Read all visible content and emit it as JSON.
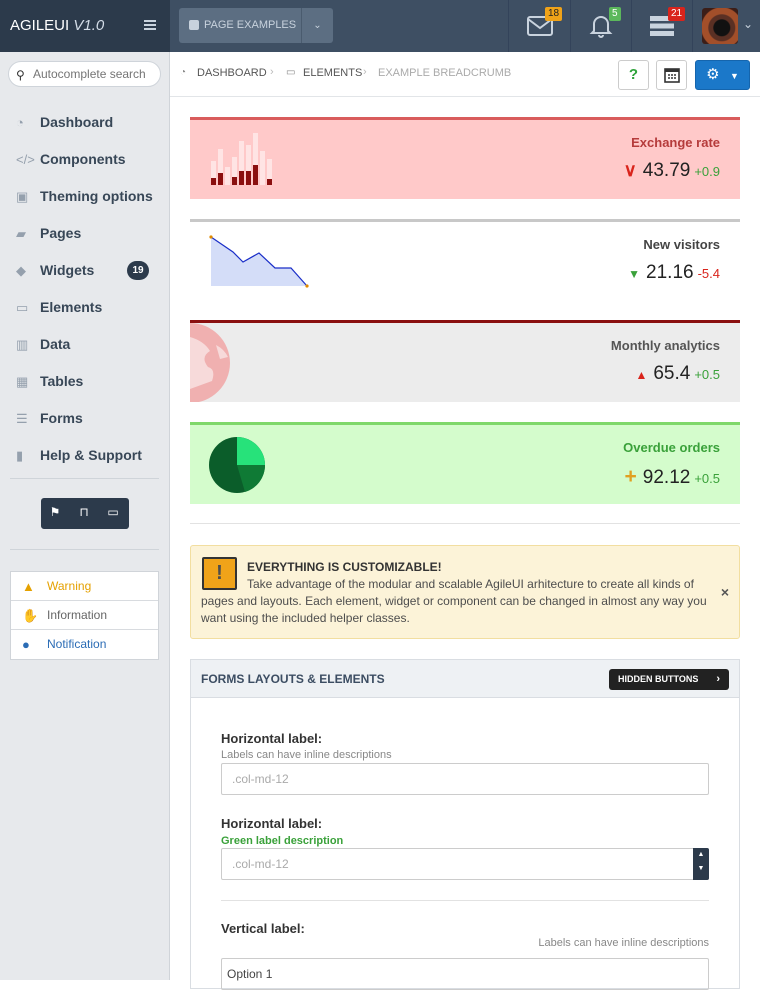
{
  "app": {
    "brand_name": "AGILEUI",
    "version": "V1.0"
  },
  "topbar": {
    "page_examples_label": "PAGE EXAMPLES",
    "messages_count": "18",
    "notifications_count": "5",
    "tasks_count": "21",
    "colors": {
      "messages_badge": "#f0a319",
      "notifications_badge": "#5cb85c",
      "tasks_badge": "#d9241c"
    }
  },
  "search": {
    "placeholder": "Autocomplete search"
  },
  "sidebar": {
    "items": [
      {
        "label": "Dashboard",
        "icon": "dashboard-icon"
      },
      {
        "label": "Components",
        "icon": "code-icon"
      },
      {
        "label": "Theming options",
        "icon": "image-icon"
      },
      {
        "label": "Pages",
        "icon": "folder-icon"
      },
      {
        "label": "Widgets",
        "icon": "tags-icon",
        "badge": "19"
      },
      {
        "label": "Elements",
        "icon": "laptop-icon"
      },
      {
        "label": "Data",
        "icon": "bar-chart-icon"
      },
      {
        "label": "Tables",
        "icon": "table-icon"
      },
      {
        "label": "Forms",
        "icon": "list-icon"
      },
      {
        "label": "Help & Support",
        "icon": "book-icon"
      }
    ],
    "notifications": [
      {
        "label": "Warning",
        "icon": "warning-icon",
        "color": "#e5a100"
      },
      {
        "label": "Information",
        "icon": "thumbs-up-icon",
        "color": "#666666"
      },
      {
        "label": "Notification",
        "icon": "comments-icon",
        "color": "#2b6cb5"
      }
    ]
  },
  "breadcrumb": {
    "items": [
      "DASHBOARD",
      "ELEMENTS",
      "EXAMPLE BREADCRUMB"
    ]
  },
  "tiles": [
    {
      "title": "Exchange rate",
      "value": "43.79",
      "delta": "+0.9"
    },
    {
      "title": "New visitors",
      "value": "21.16",
      "delta": "-5.4"
    },
    {
      "title": "Monthly analytics",
      "value": "65.4",
      "delta": "+0.5"
    },
    {
      "title": "Overdue orders",
      "value": "92.12",
      "delta": "+0.5"
    }
  ],
  "alert": {
    "title": "EVERYTHING IS CUSTOMIZABLE!",
    "text": "Take advantage of the modular and scalable AgileUI arhitecture to create all kinds of pages and layouts. Each element, widget or component can be changed in almost any way you want using the included helper classes."
  },
  "form_panel": {
    "title": "FORMS LAYOUTS & ELEMENTS",
    "hidden_buttons_label": "HIDDEN BUTTONS",
    "fields": [
      {
        "label": "Horizontal label:",
        "description": "Labels can have inline descriptions",
        "placeholder": ".col-md-12"
      },
      {
        "label": "Horizontal label:",
        "description": "Green label description",
        "placeholder": ".col-md-12"
      },
      {
        "label": "Vertical label:",
        "description": "Labels can have inline descriptions",
        "value": "Option 1"
      }
    ]
  }
}
